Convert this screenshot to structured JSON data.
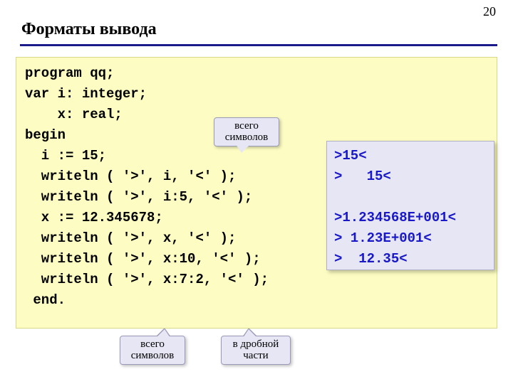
{
  "pageNumber": "20",
  "title": "Форматы вывода",
  "code": "program qq;\nvar i: integer;\n    x: real;\nbegin\n  i := 15;\n  writeln ( '>', i, '<' );\n  writeln ( '>', i:5, '<' );\n  x := 12.345678;\n  writeln ( '>', x, '<' );\n  writeln ( '>', x:10, '<' );\n  writeln ( '>', x:7:2, '<' );\n end.",
  "output": ">15<\n>   15<\n\n>1.234568E+001<\n> 1.23E+001<\n>  12.35<",
  "callouts": {
    "c1": "всего\nсимволов",
    "c2": "всего\nсимволов",
    "c3": "в дробной\nчасти"
  }
}
